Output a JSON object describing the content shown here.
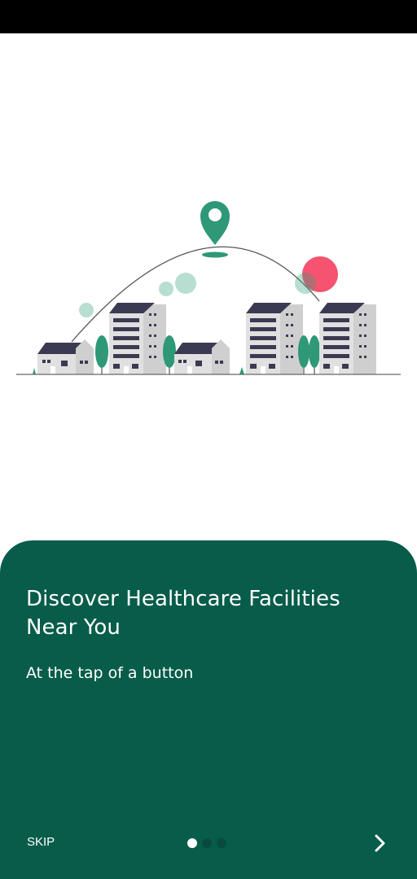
{
  "colors": {
    "panel": "#075c4a",
    "accent_green": "#31a07a",
    "pin_green": "#2e9877",
    "pink": "#f5536f",
    "building_gray": "#d9d9d9",
    "roof_dark": "#3c3a52",
    "dot_active": "#ffffff",
    "dot_inactive": "#0a4a3c",
    "status_bar": "#000000"
  },
  "onboarding": {
    "title": "Discover Healthcare Facilities Near You",
    "subtitle": "At the tap of a button",
    "skip_label": "SKIP",
    "page_indicator": {
      "count": 3,
      "active_index": 0
    },
    "next_icon": "chevron-right-icon",
    "illustration": "city-with-location-pin"
  }
}
